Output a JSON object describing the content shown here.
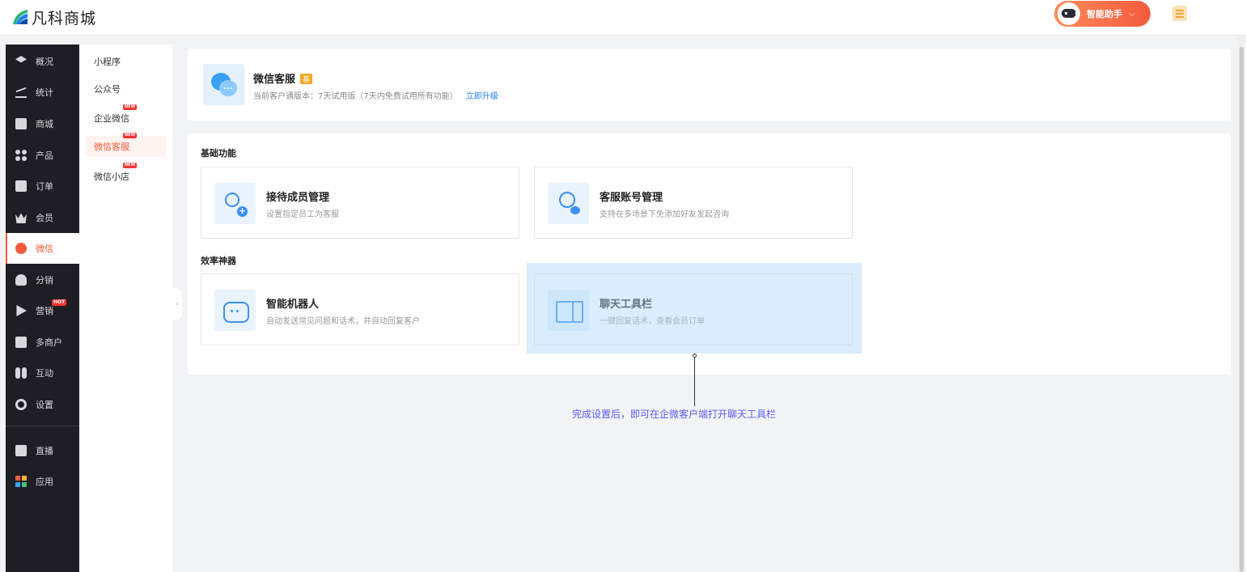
{
  "brand": {
    "name": "凡科商城"
  },
  "header": {
    "assistant_label": "智能助手",
    "assistant_chevron": "⌵"
  },
  "sidebar": {
    "items": [
      {
        "label": "概况",
        "icon": "layers-icon"
      },
      {
        "label": "统计",
        "icon": "chart-icon"
      },
      {
        "label": "商城",
        "icon": "mail-icon"
      },
      {
        "label": "产品",
        "icon": "grid-icon"
      },
      {
        "label": "订单",
        "icon": "clipboard-icon"
      },
      {
        "label": "会员",
        "icon": "crown-icon"
      },
      {
        "label": "微信",
        "icon": "chat-icon"
      },
      {
        "label": "分销",
        "icon": "user-icon"
      },
      {
        "label": "营销",
        "icon": "play-icon",
        "badge": "HOT"
      },
      {
        "label": "多商户",
        "icon": "store-icon"
      },
      {
        "label": "互动",
        "icon": "people-icon"
      },
      {
        "label": "设置",
        "icon": "gear-icon"
      },
      {
        "label": "直播",
        "icon": "tv-icon"
      },
      {
        "label": "应用",
        "icon": "apps-icon"
      }
    ]
  },
  "subnav": {
    "items": [
      {
        "label": "小程序"
      },
      {
        "label": "公众号"
      },
      {
        "label": "企业微信",
        "badge": "NEW"
      },
      {
        "label": "微信客服",
        "badge": "NEW"
      },
      {
        "label": "微信小店",
        "badge": "NEW"
      }
    ],
    "collapse_glyph": "‹"
  },
  "product": {
    "title": "微信客服",
    "tag": "基",
    "subtitle": "当前客户通版本：7天试用版（7天内免费试用所有功能）",
    "upgrade_link": "立即升级"
  },
  "sections": {
    "basic": {
      "title": "基础功能",
      "features": [
        {
          "title": "接待成员管理",
          "desc": "设置指定员工为客服"
        },
        {
          "title": "客服账号管理",
          "desc": "支持在多场景下免添加好友发起咨询"
        }
      ]
    },
    "efficiency": {
      "title": "效率神器",
      "features": [
        {
          "title": "智能机器人",
          "desc": "自动发送常见问题和话术，并自动回复客户"
        },
        {
          "title": "聊天工具栏",
          "desc": "一键回复话术，查看会员订单"
        }
      ]
    }
  },
  "tooltip": {
    "text": "完成设置后，即可在企微客户端打开聊天工具栏"
  },
  "colors": {
    "accent": "#f35b3d",
    "link": "#1d7ff5",
    "icon_blue": "#3a8ef6",
    "tip": "#5a5af0"
  }
}
